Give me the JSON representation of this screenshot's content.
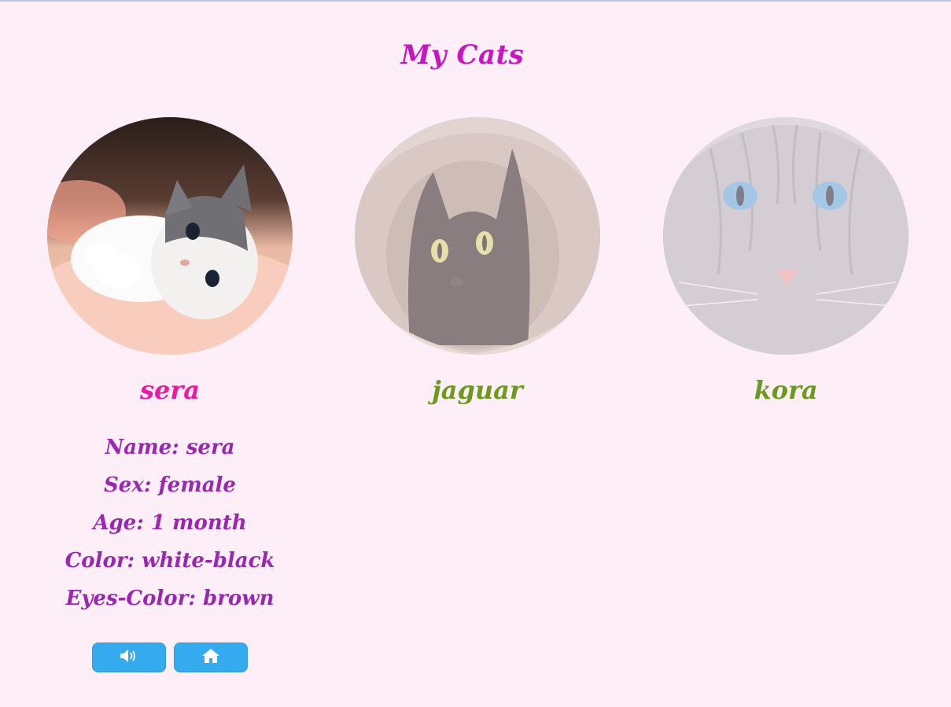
{
  "page": {
    "title": "My Cats"
  },
  "cats": [
    {
      "name": "sera",
      "selected": true,
      "details": {
        "name": "Name: sera",
        "sex": "Sex: female",
        "age": "Age: 1 month",
        "color": "Color: white-black",
        "eyes": "Eyes-Color: brown"
      }
    },
    {
      "name": "jaguar",
      "selected": false
    },
    {
      "name": "kora",
      "selected": false
    }
  ],
  "buttons": {
    "sound_icon": "volume-icon",
    "home_icon": "home-icon"
  },
  "colors": {
    "background": "#fdeef7",
    "title": "#c417c1",
    "selected_name": "#e81aa6",
    "unselected_name": "#6b9a1f",
    "details": "#9a27b0",
    "button": "#35aaee"
  }
}
